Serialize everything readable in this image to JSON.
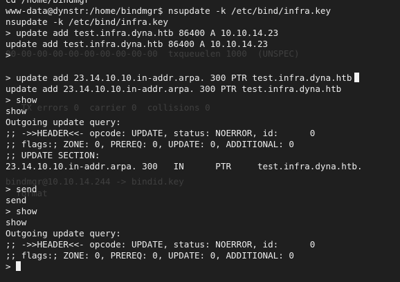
{
  "terminal": {
    "lines": [
      "cd /home/bindmgr",
      "www-data@dynstr:/home/bindmgr$ nsupdate -k /etc/bind/infra.key",
      "nsupdate -k /etc/bind/infra.key",
      "> update add test.infra.dyna.htb 86400 A 10.10.14.23",
      "update add test.infra.dyna.htb 86400 A 10.10.14.23",
      ">",
      "",
      "> update add 23.14.10.10.in-addr.arpa. 300 PTR test.infra.dyna.htb",
      "update add 23.14.10.10.in-addr.arpa. 300 PTR test.infra.dyna.htb",
      "> show",
      "show",
      "Outgoing update query:",
      ";; ->>HEADER<<- opcode: UPDATE, status: NOERROR, id:      0",
      ";; flags:; ZONE: 0, PREREQ: 0, UPDATE: 0, ADDITIONAL: 0",
      ";; UPDATE SECTION:",
      "23.14.10.10.in-addr.arpa. 300   IN      PTR     test.infra.dyna.htb.",
      "",
      "> send",
      "send",
      "> show",
      "show",
      "Outgoing update query:",
      ";; ->>HEADER<<- opcode: UPDATE, status: NOERROR, id:      0",
      ";; flags:; ZONE: 0, PREREQ: 0, UPDATE: 0, ADDITIONAL: 0",
      ">"
    ]
  }
}
